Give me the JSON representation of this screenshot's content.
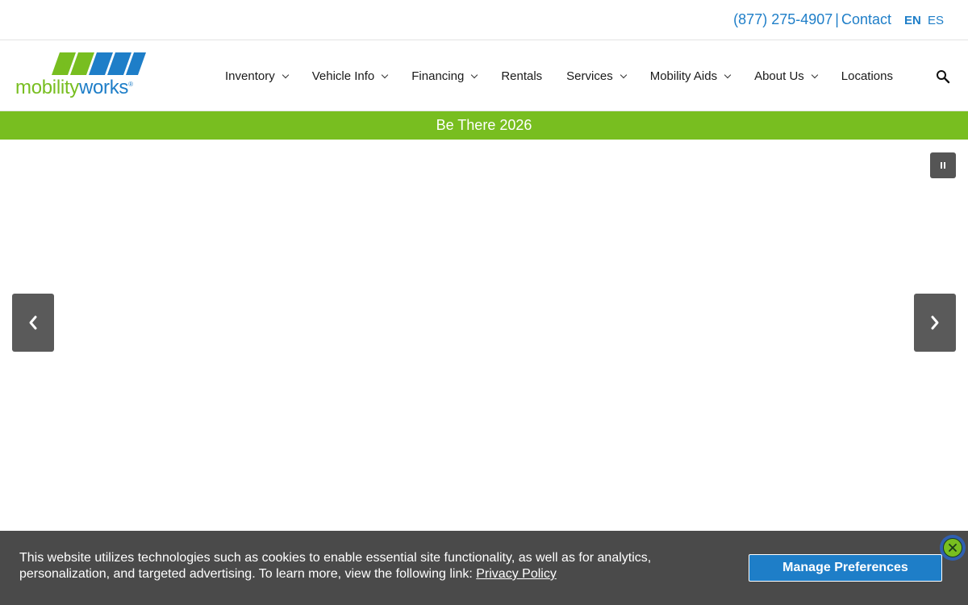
{
  "topbar": {
    "phone": "(877) 275-4907",
    "separator": "|",
    "contact_label": "Contact",
    "lang_en": "EN",
    "lang_es": "ES"
  },
  "logo": {
    "text_mobility": "mobility",
    "text_works": "works",
    "registered": "®"
  },
  "nav": {
    "items": [
      {
        "label": "Inventory",
        "has_dropdown": true
      },
      {
        "label": "Vehicle Info",
        "has_dropdown": true
      },
      {
        "label": "Financing",
        "has_dropdown": true
      },
      {
        "label": "Rentals",
        "has_dropdown": false
      },
      {
        "label": "Services",
        "has_dropdown": true
      },
      {
        "label": "Mobility Aids",
        "has_dropdown": true
      },
      {
        "label": "About Us",
        "has_dropdown": true
      },
      {
        "label": "Locations",
        "has_dropdown": false
      }
    ],
    "search_icon": "search-icon"
  },
  "promo": {
    "text": "Be There 2026"
  },
  "hero": {
    "pause_icon": "pause-icon",
    "prev_icon": "chevron-left-icon",
    "next_icon": "chevron-right-icon"
  },
  "cookie": {
    "text": "This website utilizes technologies such as cookies to enable essential site functionality, as well as for analytics, personalization, and targeted advertising. To learn more, view the following link: ",
    "link_label": "Privacy Policy",
    "manage_label": "Manage Preferences",
    "close_icon": "close-icon"
  },
  "colors": {
    "brand_blue": "#1e7ec8",
    "brand_green": "#78be20",
    "cookie_bg": "#4a4a4a",
    "arrow_bg": "#5a5a5a"
  }
}
